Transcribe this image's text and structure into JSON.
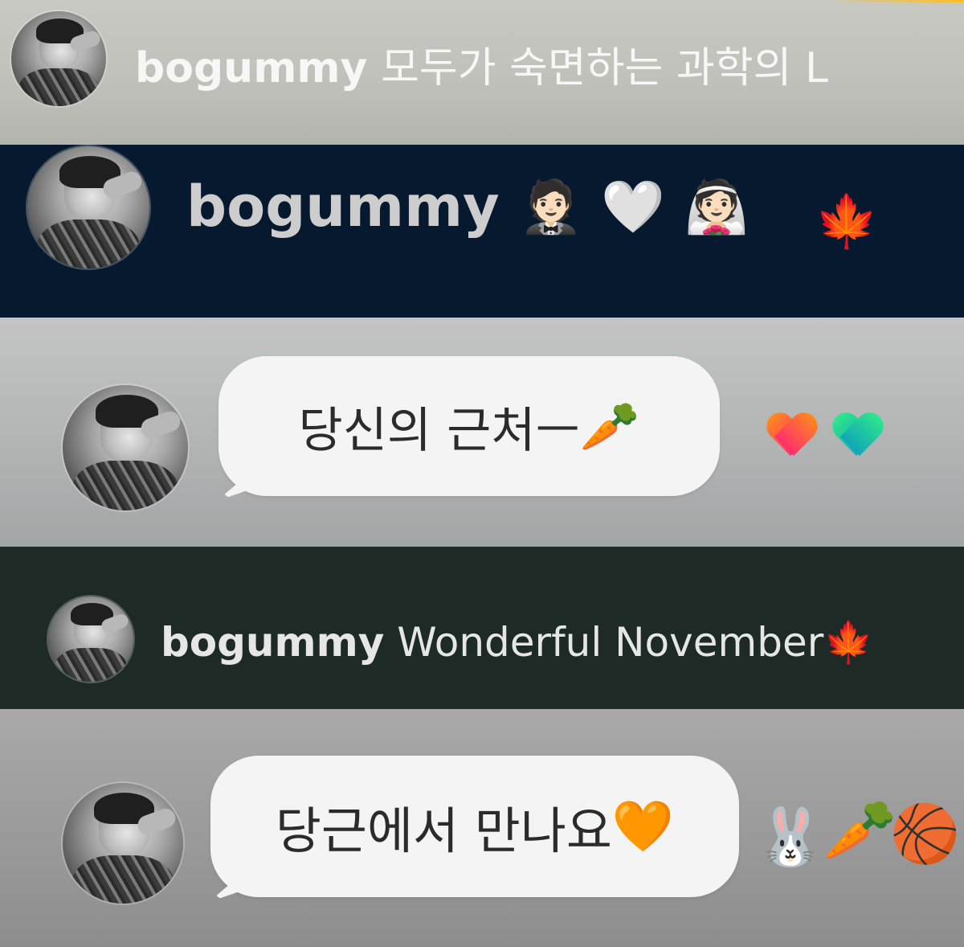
{
  "strips": [
    {
      "username": "bogummy",
      "caption": "모두가 숙면하는 과학의 L",
      "emojis": []
    },
    {
      "username": "bogummy",
      "caption": "",
      "emojis": [
        "🤵🏻",
        "🤍",
        "👰🏻",
        "🍁"
      ]
    },
    {
      "message": "당신의 근처ㅡ",
      "message_emoji": "🥕",
      "emojis": [
        "🧡",
        "💚"
      ]
    },
    {
      "username": "bogummy",
      "caption": "Wonderful November",
      "caption_emoji": "🍁",
      "emojis": []
    },
    {
      "message": "당근에서 만나요",
      "message_emoji": "🧡",
      "emojis": [
        "🐰",
        "🥕",
        "🏀"
      ]
    }
  ],
  "colors": {
    "strip1_bg": "#c4c6bf",
    "strip2_bg": "#07192e",
    "strip3_bg": "#b4b6b6",
    "strip4_bg": "#1d2a26",
    "strip5_bg": "#9a9a9a",
    "bubble": "#f4f4f4"
  },
  "icons": {
    "avatar": "profile-photo-avatar",
    "maple": "maple-leaf-icon",
    "carrot": "carrot-icon",
    "heart": "heart-icon",
    "rabbit": "rabbit-face-icon",
    "basketball": "basketball-icon"
  }
}
